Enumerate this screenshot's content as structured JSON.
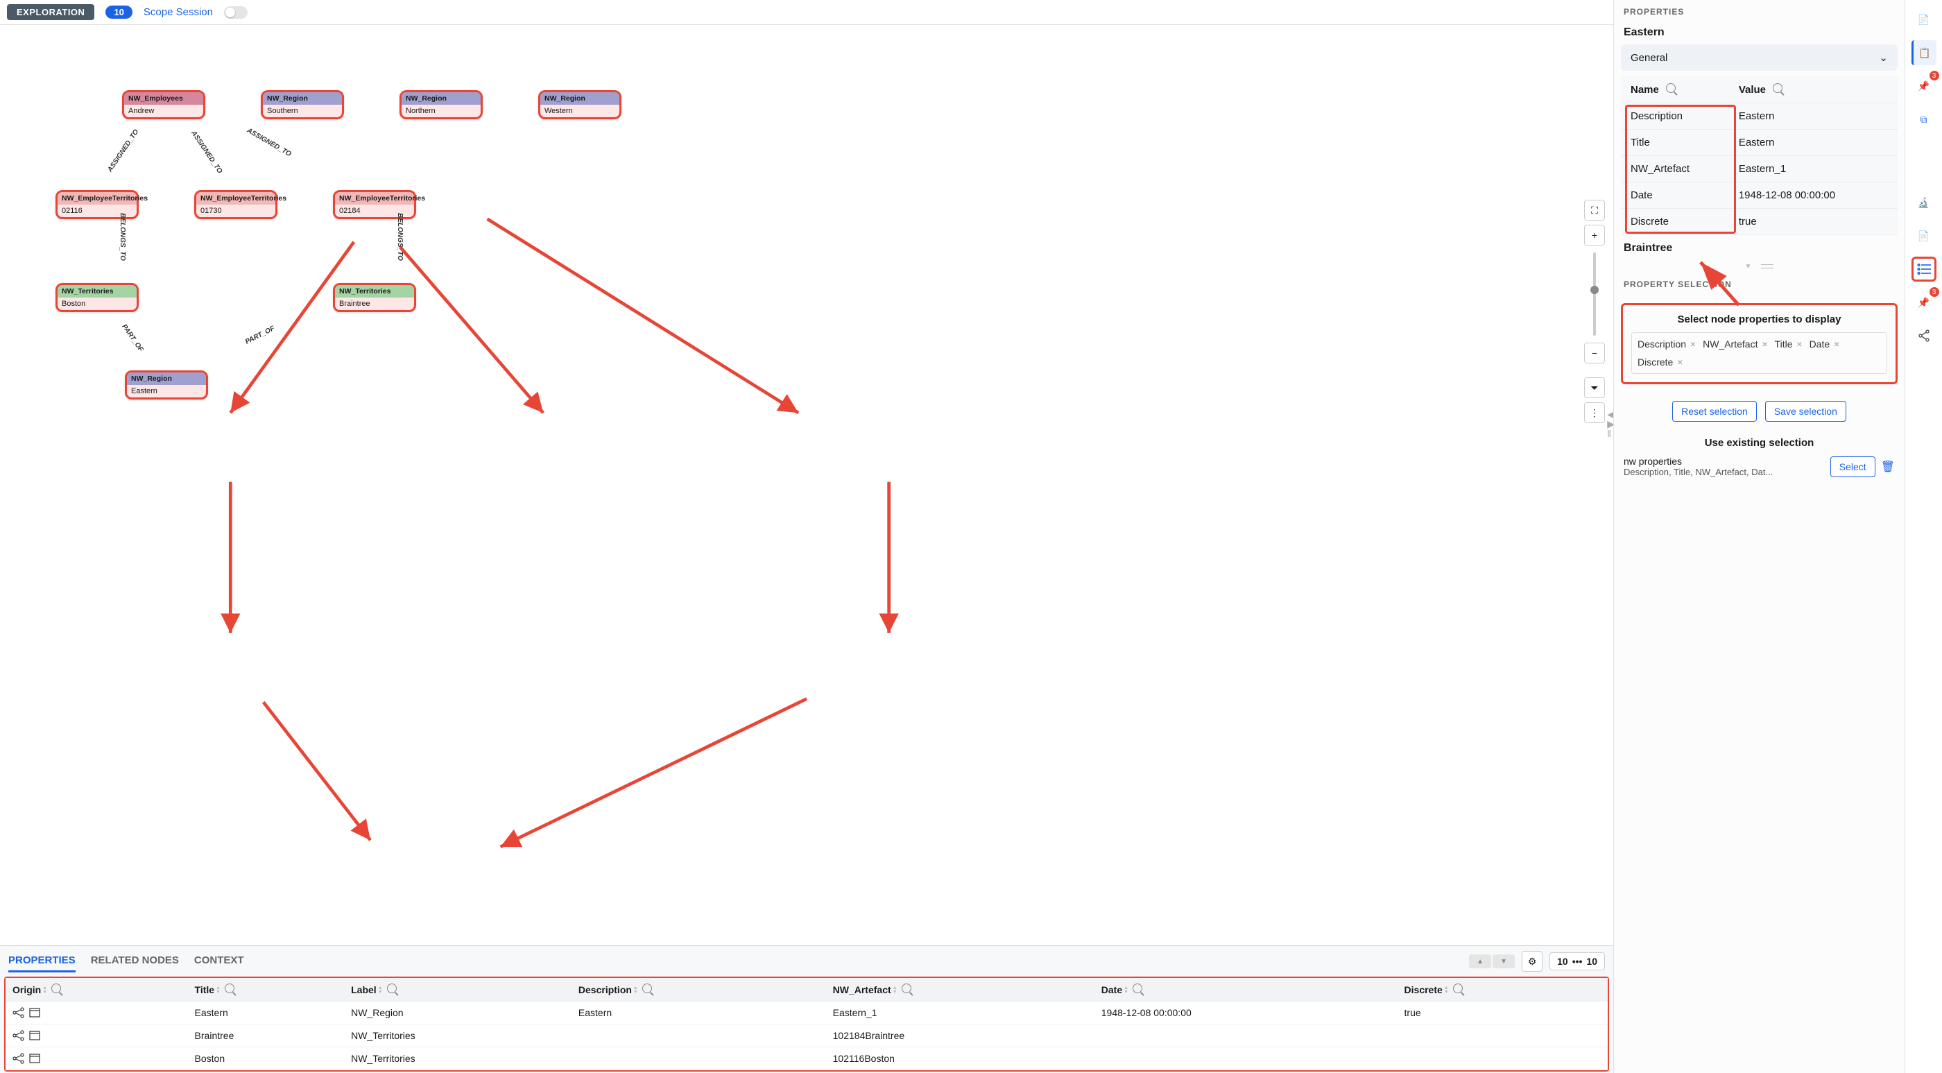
{
  "topbar": {
    "badge": "EXPLORATION",
    "count": "10",
    "scope_label": "Scope Session"
  },
  "graph": {
    "nodes": {
      "emp": {
        "type": "NW_Employees",
        "value": "Andrew"
      },
      "reg_s": {
        "type": "NW_Region",
        "value": "Southern"
      },
      "reg_n": {
        "type": "NW_Region",
        "value": "Northern"
      },
      "reg_w": {
        "type": "NW_Region",
        "value": "Western"
      },
      "et1": {
        "type": "NW_EmployeeTerritories",
        "value": "02116"
      },
      "et2": {
        "type": "NW_EmployeeTerritories",
        "value": "01730"
      },
      "et3": {
        "type": "NW_EmployeeTerritories",
        "value": "02184"
      },
      "t_boston": {
        "type": "NW_Territories",
        "value": "Boston"
      },
      "t_brain": {
        "type": "NW_Territories",
        "value": "Braintree"
      },
      "reg_e": {
        "type": "NW_Region",
        "value": "Eastern"
      }
    },
    "edge_labels": {
      "assigned": "ASSIGNED_TO",
      "belongs": "BELONGS_TO",
      "part": "PART_OF"
    }
  },
  "bottom": {
    "tabs": [
      "PROPERTIES",
      "RELATED NODES",
      "CONTEXT"
    ],
    "active_tab": 0,
    "left_count": "10",
    "right_count": "10",
    "columns": [
      "Origin",
      "Title",
      "Label",
      "Description",
      "NW_Artefact",
      "Date",
      "Discrete"
    ],
    "rows": [
      {
        "title": "Eastern",
        "label": "NW_Region",
        "description": "Eastern",
        "artefact": "Eastern_1",
        "date": "1948-12-08 00:00:00",
        "discrete": "true"
      },
      {
        "title": "Braintree",
        "label": "NW_Territories",
        "description": "",
        "artefact": "102184Braintree",
        "date": "",
        "discrete": ""
      },
      {
        "title": "Boston",
        "label": "NW_Territories",
        "description": "",
        "artefact": "102116Boston",
        "date": "",
        "discrete": ""
      }
    ]
  },
  "right": {
    "panel_title": "PROPERTIES",
    "entity": "Eastern",
    "accordion": "General",
    "name_header": "Name",
    "value_header": "Value",
    "rows": [
      {
        "name": "Description",
        "value": "Eastern"
      },
      {
        "name": "Title",
        "value": "Eastern"
      },
      {
        "name": "NW_Artefact",
        "value": "Eastern_1"
      },
      {
        "name": "Date",
        "value": "1948-12-08 00:00:00"
      },
      {
        "name": "Discrete",
        "value": "true"
      }
    ],
    "entity2": "Braintree",
    "psel_title": "PROPERTY SELECTION",
    "psel_heading": "Select node properties to display",
    "tags": [
      "Description",
      "NW_Artefact",
      "Title",
      "Date",
      "Discrete"
    ],
    "reset": "Reset selection",
    "save": "Save selection",
    "use_existing": "Use existing selection",
    "saved_name": "nw properties",
    "saved_desc": "Description, Title, NW_Artefact, Dat...",
    "select_btn": "Select"
  },
  "rail": {
    "pin_badge1": "3",
    "pin_badge2": "3"
  }
}
